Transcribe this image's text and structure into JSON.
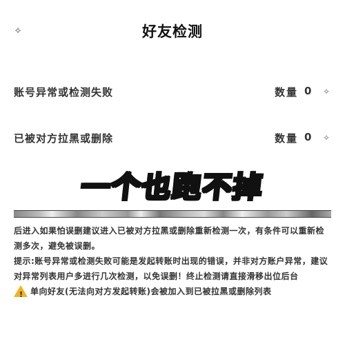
{
  "header": {
    "title": "好友检测",
    "back_icon": "⟡"
  },
  "rows": [
    {
      "label": "账号异常或检测失败",
      "count_label": "数量",
      "count_value": "0",
      "icon": "⟡"
    },
    {
      "label": "已被对方拉黑或删除",
      "count_label": "数量",
      "count_value": "0",
      "icon": "⟡"
    }
  ],
  "banner": {
    "text": "一个也跑不掉"
  },
  "notes": [
    "后进入如果怕误删建议进入已被对方拉黑或删除重新检测一次，有条件可以重新检测多次，避免被误删。",
    "提示:账号异常或检测失败可能是发起转账时出现的错误，并非对方账户异常，建议对异常列表用户多进行几次检测，以免误删！终止检测请直接滑移出位后台",
    "单向好友(无法向对方发起转账)会被加入到已被拉黑或删除列表"
  ],
  "colors": {
    "banner_fill": "#f7e98a",
    "warning": "#f2b31c"
  }
}
